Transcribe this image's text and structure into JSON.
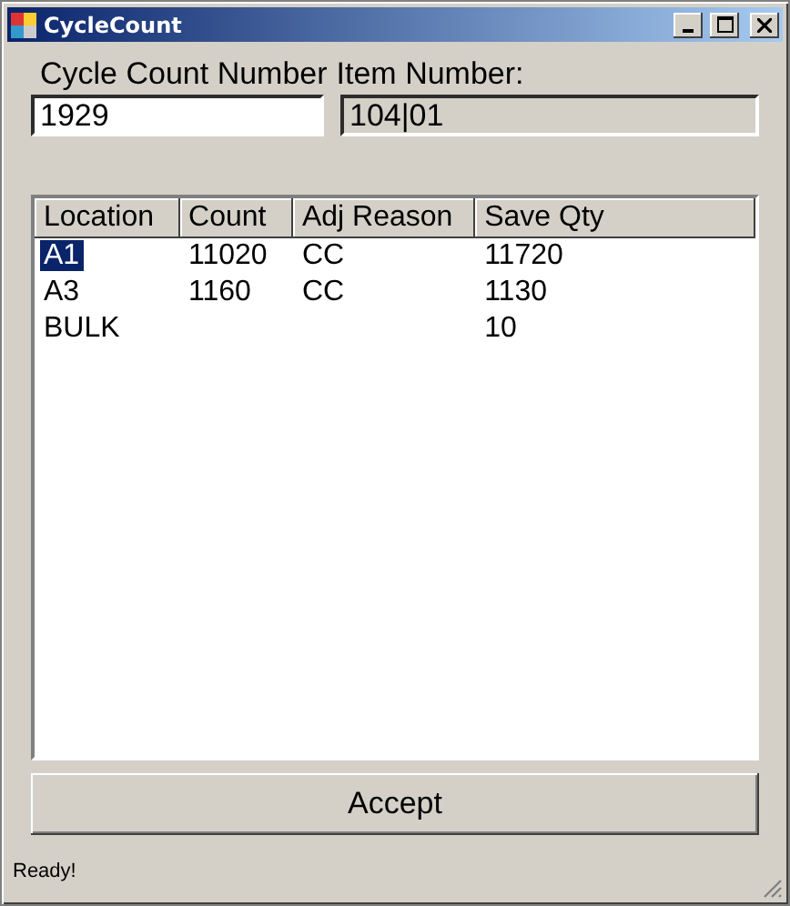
{
  "window": {
    "title": "CycleCount"
  },
  "labels": [
    "Cycle Count Number",
    "Item Number:"
  ],
  "fields": [
    {
      "value": "1929",
      "disabled": false
    },
    {
      "value": "104|01",
      "disabled": true
    }
  ],
  "table": {
    "columns": [
      "Location",
      "Count",
      "Adj Reason",
      "Save Qty"
    ],
    "rows": [
      {
        "cells": [
          "A1",
          "11020",
          "CC",
          "11720"
        ],
        "selected": true
      },
      {
        "cells": [
          "A3",
          "1160",
          "CC",
          "1130"
        ],
        "selected": false
      },
      {
        "cells": [
          "BULK",
          "",
          "",
          "10"
        ],
        "selected": false
      }
    ]
  },
  "accept_button": "Accept",
  "status_bar": "Ready!"
}
